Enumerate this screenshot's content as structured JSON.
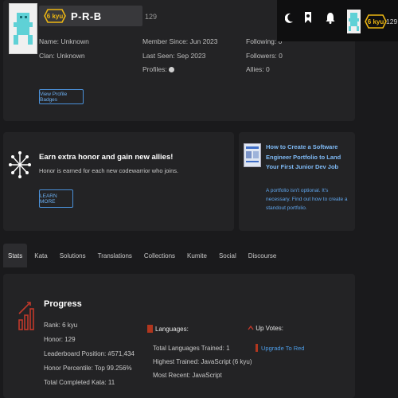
{
  "profile": {
    "rank_badge": "6 kyu",
    "username": "P-R-B",
    "honor": "129",
    "col1": [
      "Name: Unknown",
      "Clan: Unknown"
    ],
    "col2": [
      "Member Since: Jun 2023",
      "Last Seen: Sep 2023",
      "Profiles:"
    ],
    "col3": [
      "Following: 0",
      "Followers: 0",
      "Allies: 0"
    ],
    "view_badges_label": "View Profile Badges"
  },
  "top_nav": {
    "icons": [
      "moon-icon",
      "bookmark-icon",
      "bell-icon"
    ],
    "rank_badge": "6 kyu",
    "honor": "129"
  },
  "honor_card": {
    "title": "Earn extra honor and gain new allies!",
    "subtitle": "Honor is earned for each new codewarrior who joins.",
    "button_label": "LEARN MORE"
  },
  "blog_card": {
    "title": "How to Create a Software Engineer Portfolio to Land Your First Junior Dev Job",
    "description": "A portfolio isn't optional. It's necessary. Find out how to create a standout portfolio."
  },
  "tabs": [
    "Stats",
    "Kata",
    "Solutions",
    "Translations",
    "Collections",
    "Kumite",
    "Social",
    "Discourse"
  ],
  "active_tab": "Stats",
  "stats": {
    "progress_title": "Progress",
    "progress_items": [
      "Rank: 6 kyu",
      "Honor: 129",
      "Leaderboard Position: #571,434",
      "Honor Percentile: Top 99.256%",
      "Total Completed Kata: 11"
    ],
    "languages_title": "Languages:",
    "language_items": [
      "Total Languages Trained: 1",
      "Highest Trained: JavaScript (6 kyu)",
      "Most Recent: JavaScript"
    ],
    "upvotes_title": "Up Votes:",
    "upvote_link": "Upgrade To Red"
  },
  "colors": {
    "background": "#1a1a1c",
    "card": "#232325",
    "rank_yellow": "#ecb613",
    "link_blue": "#4a90d9",
    "accent_red": "#b1361e"
  }
}
